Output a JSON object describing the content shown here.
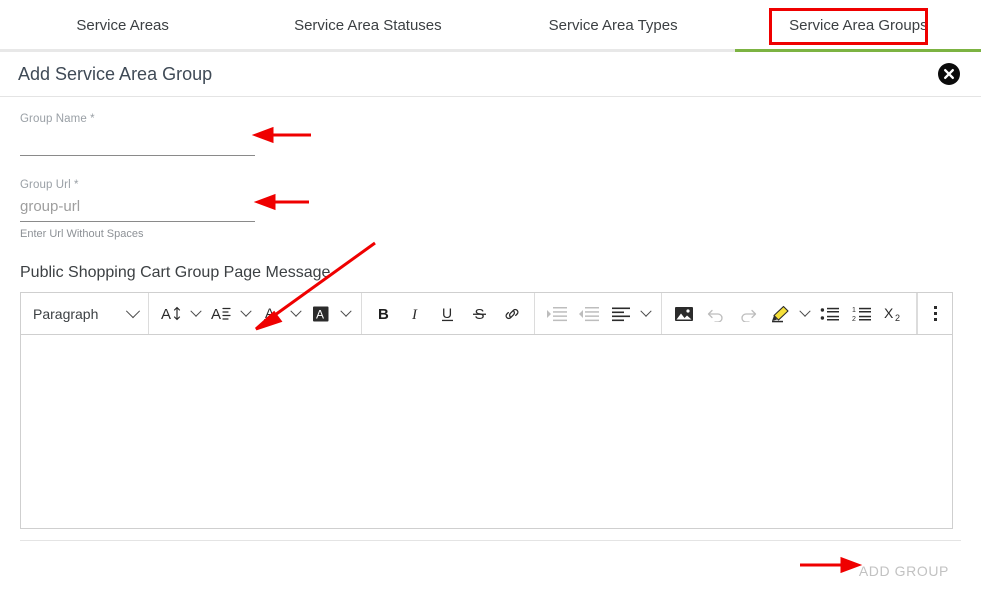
{
  "tabs": [
    {
      "label": "Service Areas",
      "active": false
    },
    {
      "label": "Service Area Statuses",
      "active": false
    },
    {
      "label": "Service Area Types",
      "active": false
    },
    {
      "label": "Service Area Groups",
      "active": true
    }
  ],
  "panel": {
    "title": "Add Service Area Group",
    "close_icon": "close-circle-icon"
  },
  "form": {
    "group_name": {
      "label": "Group Name *",
      "value": "",
      "placeholder": ""
    },
    "group_url": {
      "label": "Group Url *",
      "value": "",
      "placeholder": "group-url",
      "hint": "Enter Url Without Spaces"
    },
    "message_section_title": "Public Shopping Cart Group Page Message"
  },
  "editor": {
    "block_format": "Paragraph",
    "content": "",
    "toolbar": [
      {
        "name": "block-format-select",
        "label": "Paragraph",
        "icon": "chevron-down-icon"
      },
      {
        "name": "font-size-button",
        "label": "Font Size",
        "icon": "font-size-icon"
      },
      {
        "name": "line-height-button",
        "label": "Line Height",
        "icon": "line-height-icon"
      },
      {
        "name": "text-color-button",
        "label": "Text Color",
        "icon": "text-color-icon"
      },
      {
        "name": "background-color-button",
        "label": "Background Color",
        "icon": "background-color-icon"
      },
      {
        "name": "bold-button",
        "label": "Bold",
        "icon": "bold-icon"
      },
      {
        "name": "italic-button",
        "label": "Italic",
        "icon": "italic-icon"
      },
      {
        "name": "underline-button",
        "label": "Underline",
        "icon": "underline-icon"
      },
      {
        "name": "strikethrough-button",
        "label": "Strikethrough",
        "icon": "strikethrough-icon"
      },
      {
        "name": "link-button",
        "label": "Link",
        "icon": "link-icon"
      },
      {
        "name": "indent-button",
        "label": "Indent",
        "icon": "indent-icon",
        "disabled": true
      },
      {
        "name": "outdent-button",
        "label": "Outdent",
        "icon": "outdent-icon",
        "disabled": true
      },
      {
        "name": "align-button",
        "label": "Align",
        "icon": "align-left-icon"
      },
      {
        "name": "image-button",
        "label": "Image",
        "icon": "image-icon"
      },
      {
        "name": "undo-button",
        "label": "Undo",
        "icon": "undo-icon",
        "disabled": true
      },
      {
        "name": "redo-button",
        "label": "Redo",
        "icon": "redo-icon",
        "disabled": true
      },
      {
        "name": "highlight-button",
        "label": "Highlight",
        "icon": "highlighter-icon"
      },
      {
        "name": "bulleted-list-button",
        "label": "Bulleted List",
        "icon": "bulleted-list-icon"
      },
      {
        "name": "numbered-list-button",
        "label": "Numbered List",
        "icon": "numbered-list-icon"
      },
      {
        "name": "subscript-button",
        "label": "Subscript",
        "icon": "subscript-icon"
      },
      {
        "name": "more-options-button",
        "label": "More",
        "icon": "vertical-dots-icon"
      }
    ]
  },
  "footer": {
    "add_group_label": "ADD GROUP",
    "add_group_disabled": true
  },
  "colors": {
    "active_tab_underline": "#7cb342",
    "annotation": "#ef0000",
    "highlighter": "#f5e03a",
    "disabled_text": "#c2c2c2"
  },
  "annotations": {
    "tab_highlight_box": "Service Area Groups",
    "arrows": [
      {
        "name": "arrow-to-group-name-field",
        "direction": "left"
      },
      {
        "name": "arrow-to-group-url-field",
        "direction": "left"
      },
      {
        "name": "arrow-to-editor-body",
        "direction": "down-left"
      },
      {
        "name": "arrow-to-add-group-button",
        "direction": "right"
      }
    ]
  }
}
